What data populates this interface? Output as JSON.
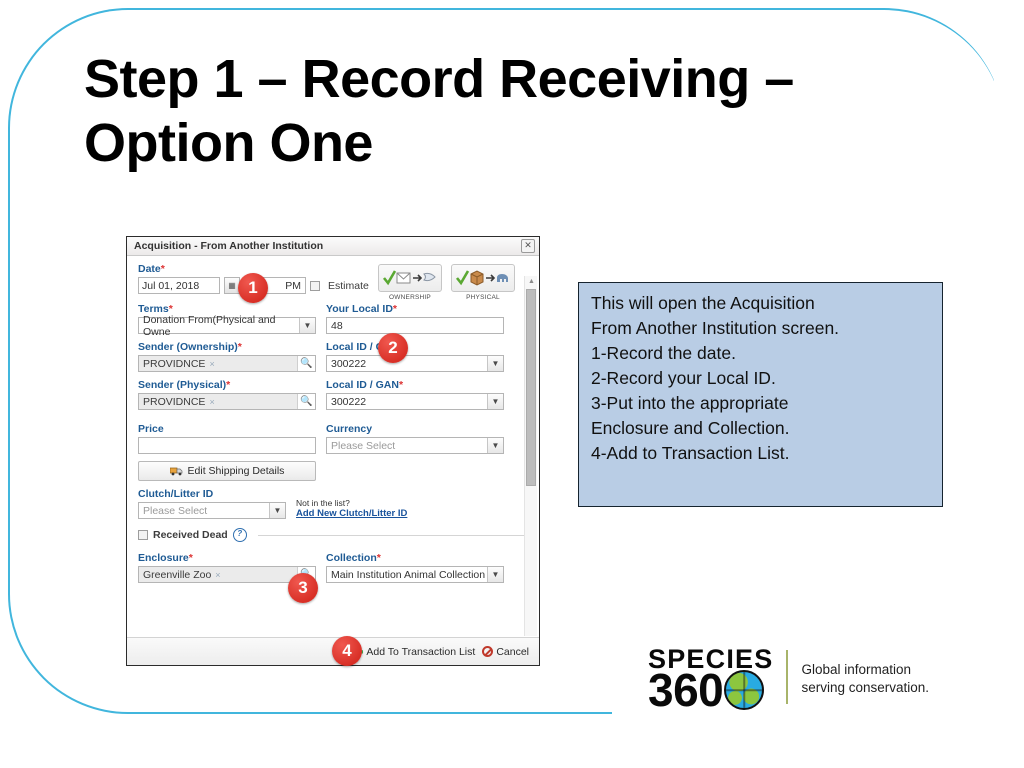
{
  "slide": {
    "title": "Step 1 – Record Receiving – Option One",
    "frame_color": "#41b6dd"
  },
  "dialog": {
    "title": "Acquisition - From Another Institution",
    "close_label": "✕",
    "date": {
      "label": "Date",
      "required_mark": "*",
      "value": "Jul 01, 2018",
      "picker_icon": "calendar-icon",
      "time_value": "PM",
      "estimate_label": "Estimate"
    },
    "transfer_buttons": [
      {
        "caption": "OWNERSHIP",
        "icon": "ownership-transfer-icon"
      },
      {
        "caption": "PHYSICAL",
        "icon": "physical-transfer-icon"
      }
    ],
    "terms": {
      "label": "Terms",
      "required_mark": "*",
      "value": "Donation From(Physical and Owne"
    },
    "local_id": {
      "label": "Your Local ID",
      "required_mark": "*",
      "value": "48"
    },
    "sender_ownership": {
      "label": "Sender (Ownership)",
      "required_mark": "*",
      "value": "PROVIDNCE",
      "chip_remove": "×"
    },
    "local_id_gan_ownership": {
      "label": "Local ID / GAN",
      "required_mark": "*",
      "value": "300222"
    },
    "sender_physical": {
      "label": "Sender (Physical)",
      "required_mark": "*",
      "value": "PROVIDNCE",
      "chip_remove": "×"
    },
    "local_id_gan_physical": {
      "label": "Local ID / GAN",
      "required_mark": "*",
      "value": "300222"
    },
    "price": {
      "label": "Price",
      "value": ""
    },
    "currency": {
      "label": "Currency",
      "value": "Please Select"
    },
    "shipping_button": {
      "label": "Edit Shipping Details",
      "icon": "truck-icon"
    },
    "clutch_litter": {
      "label": "Clutch/Litter ID",
      "value": "Please Select",
      "not_in_list_text": "Not in the list?",
      "add_new_link": "Add New Clutch/Litter ID"
    },
    "received_dead": {
      "label": "Received Dead",
      "help_icon": "help-question-icon"
    },
    "enclosure": {
      "label": "Enclosure",
      "required_mark": "*",
      "value": "Greenville Zoo",
      "chip_remove": "×"
    },
    "collection": {
      "label": "Collection",
      "required_mark": "*",
      "value": "Main Institution Animal Collection"
    },
    "footer": {
      "add_label": "Add To Transaction List",
      "cancel_label": "Cancel"
    },
    "scrollbar": {
      "up_arrow": "▲",
      "down_arrow": "▼"
    }
  },
  "badges": {
    "one": "1",
    "two": "2",
    "three": "3",
    "four": "4"
  },
  "callout": {
    "background": "#b9cde5",
    "lines": [
      "This will open the Acquisition",
      "From Another Institution screen.",
      "1-Record the date.",
      "2-Record your Local ID.",
      "3-Put into the appropriate",
      "Enclosure and Collection.",
      "4-Add to Transaction List."
    ]
  },
  "logo": {
    "species": "SPECIES",
    "number": "360",
    "tagline_line1": "Global information",
    "tagline_line2": "serving conservation."
  }
}
